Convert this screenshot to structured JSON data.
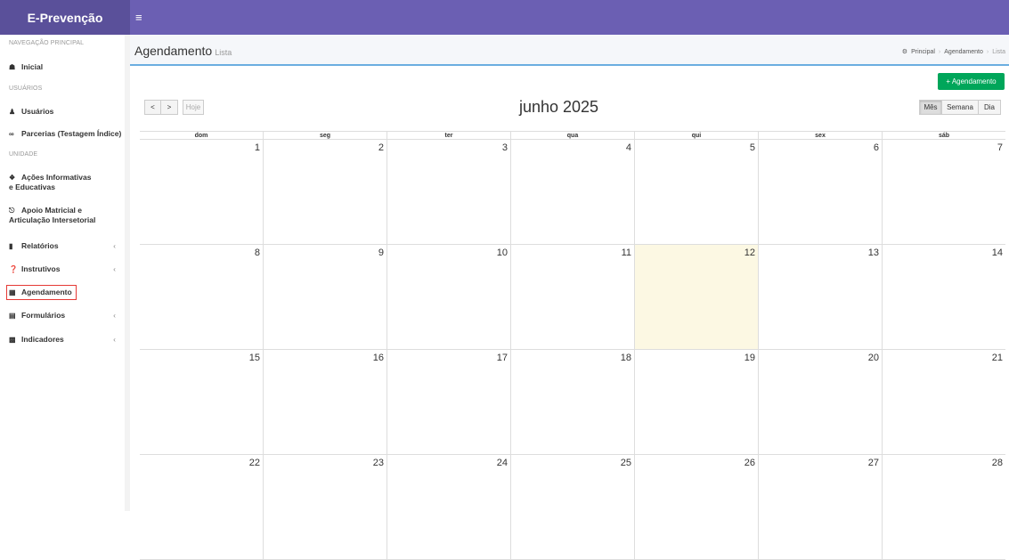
{
  "brand": "E-Prevenção",
  "hamburger_icon": "≡",
  "sidebar": {
    "header_nav": "NAVEGAÇÃO PRINCIPAL",
    "item_inicial": "Inicial",
    "header_users": "USUÁRIOS",
    "item_usuarios": "Usuários",
    "item_parcerias": "Parcerias (Testagem Índice)",
    "header_unidade": "UNIDADE",
    "item_acoes_1": "Ações Informativas",
    "item_acoes_2": "e Educativas",
    "item_apoio_1": "Apoio Matricial e",
    "item_apoio_2": "Articulação Intersetorial",
    "item_relatorios": "Relatórios",
    "item_instrutivos": "Instrutivos",
    "item_agendamento": "Agendamento",
    "item_formularios": "Formulários",
    "item_indicadores": "Indicadores",
    "chevron": "‹"
  },
  "header": {
    "title": "Agendamento",
    "subtitle": "Lista",
    "breadcrumb": [
      "Principal",
      "Agendamento",
      "Lista"
    ],
    "breadcrumb_sep": "›"
  },
  "add_button": "+ Agendamento",
  "calendar": {
    "prev": "<",
    "next": ">",
    "today_btn": "Hoje",
    "title": "junho 2025",
    "views": [
      "Mês",
      "Semana",
      "Dia"
    ],
    "active_view": "Mês",
    "weekdays": [
      "dom",
      "seg",
      "ter",
      "qua",
      "qui",
      "sex",
      "sáb"
    ],
    "weeks": [
      [
        "1",
        "2",
        "3",
        "4",
        "5",
        "6",
        "7"
      ],
      [
        "8",
        "9",
        "10",
        "11",
        "12",
        "13",
        "14"
      ],
      [
        "15",
        "16",
        "17",
        "18",
        "19",
        "20",
        "21"
      ],
      [
        "22",
        "23",
        "24",
        "25",
        "26",
        "27",
        "28"
      ]
    ],
    "today": "12"
  },
  "colors": {
    "brand_bg": "#5A509A",
    "navbar_bg": "#6B5FB3",
    "add_button": "#00A65A",
    "today_bg": "#FCF8E3",
    "active_outline": "#E53935"
  }
}
